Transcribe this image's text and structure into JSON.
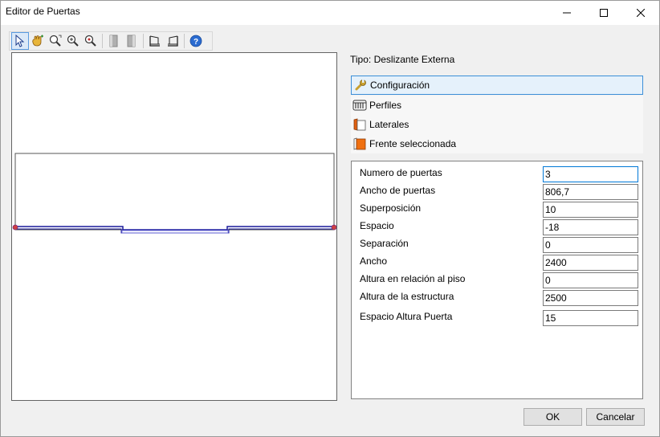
{
  "window": {
    "title": "Editor de Puertas"
  },
  "toolbar": {
    "buttons": [
      {
        "icon": "select-pointer-icon"
      },
      {
        "icon": "pan-hand-icon"
      },
      {
        "icon": "zoom-window-icon"
      },
      {
        "icon": "zoom-in-icon"
      },
      {
        "icon": "zoom-extents-icon"
      },
      {
        "icon": "door-left-icon"
      },
      {
        "icon": "door-right-icon"
      },
      {
        "icon": "view-left-icon"
      },
      {
        "icon": "view-right-icon"
      },
      {
        "icon": "help-icon"
      }
    ]
  },
  "tipo": "Tipo: Deslizante Externa",
  "sections": [
    {
      "label": "Configuración",
      "icon": "wrench-icon",
      "selected": true
    },
    {
      "label": "Perfiles",
      "icon": "profiles-icon",
      "selected": false
    },
    {
      "label": "Laterales",
      "icon": "side-panel-icon",
      "selected": false
    },
    {
      "label": "Frente seleccionada",
      "icon": "front-panel-icon",
      "selected": false
    }
  ],
  "properties": [
    {
      "label": "Numero de puertas",
      "value": "3"
    },
    {
      "label": "Ancho de puertas",
      "value": "806,7"
    },
    {
      "label": "Superposición",
      "value": "10"
    },
    {
      "label": "Espacio",
      "value": "-18"
    },
    {
      "label": "Separación",
      "value": "0"
    },
    {
      "label": "Ancho",
      "value": "2400"
    },
    {
      "label": "Altura en relación al piso",
      "value": "0"
    },
    {
      "label": "Altura de la estructura",
      "value": "2500"
    },
    {
      "label": "Espacio Altura Puerta",
      "value": "15"
    }
  ],
  "buttons": {
    "ok": "OK",
    "cancel": "Cancelar"
  },
  "colors": {
    "door_line": "#1a1a9c",
    "marker": "#d04040",
    "accent": "#0078d7"
  }
}
